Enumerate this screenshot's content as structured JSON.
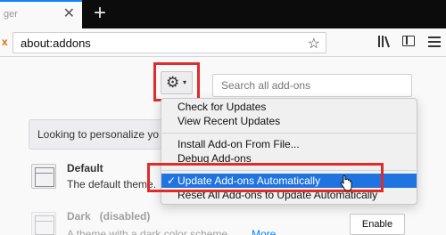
{
  "tab": {
    "label": "ger",
    "close_glyph": "✕"
  },
  "new_tab_glyph": "+",
  "navbar": {
    "left_glyph": "x",
    "url": "about:addons",
    "bookmark_glyph": "☆"
  },
  "toolbar": {
    "gear_glyph": "⚙",
    "gear_caret": "▾"
  },
  "search": {
    "placeholder": "Search all add-ons"
  },
  "banner": {
    "text": "Looking to personalize yo"
  },
  "menu": {
    "items": [
      {
        "label": "Check for Updates"
      },
      {
        "label": "View Recent Updates"
      },
      {
        "label": "Install Add-on From File..."
      },
      {
        "label": "Debug Add-ons"
      },
      {
        "label": "Update Add-ons Automatically",
        "checked": true,
        "check_glyph": "✓"
      },
      {
        "label": "Reset All Add-ons to Update Automatically"
      }
    ]
  },
  "themes": [
    {
      "title": "Default",
      "description": "The default theme."
    },
    {
      "title": "Dark   (disabled)",
      "description": "A theme with a dark color scheme.",
      "more_label": "More",
      "enable_label": "Enable"
    }
  ],
  "colors": {
    "highlight_red": "#e02b2b",
    "menu_selected": "#1f74e0",
    "link_blue": "#0a84ff"
  },
  "icons": [
    "close-icon",
    "plus-icon",
    "star-icon",
    "library-icon",
    "sidebar-icon",
    "hamburger-menu-icon",
    "gear-icon",
    "theme-icon",
    "check-icon",
    "hand-cursor-icon"
  ]
}
